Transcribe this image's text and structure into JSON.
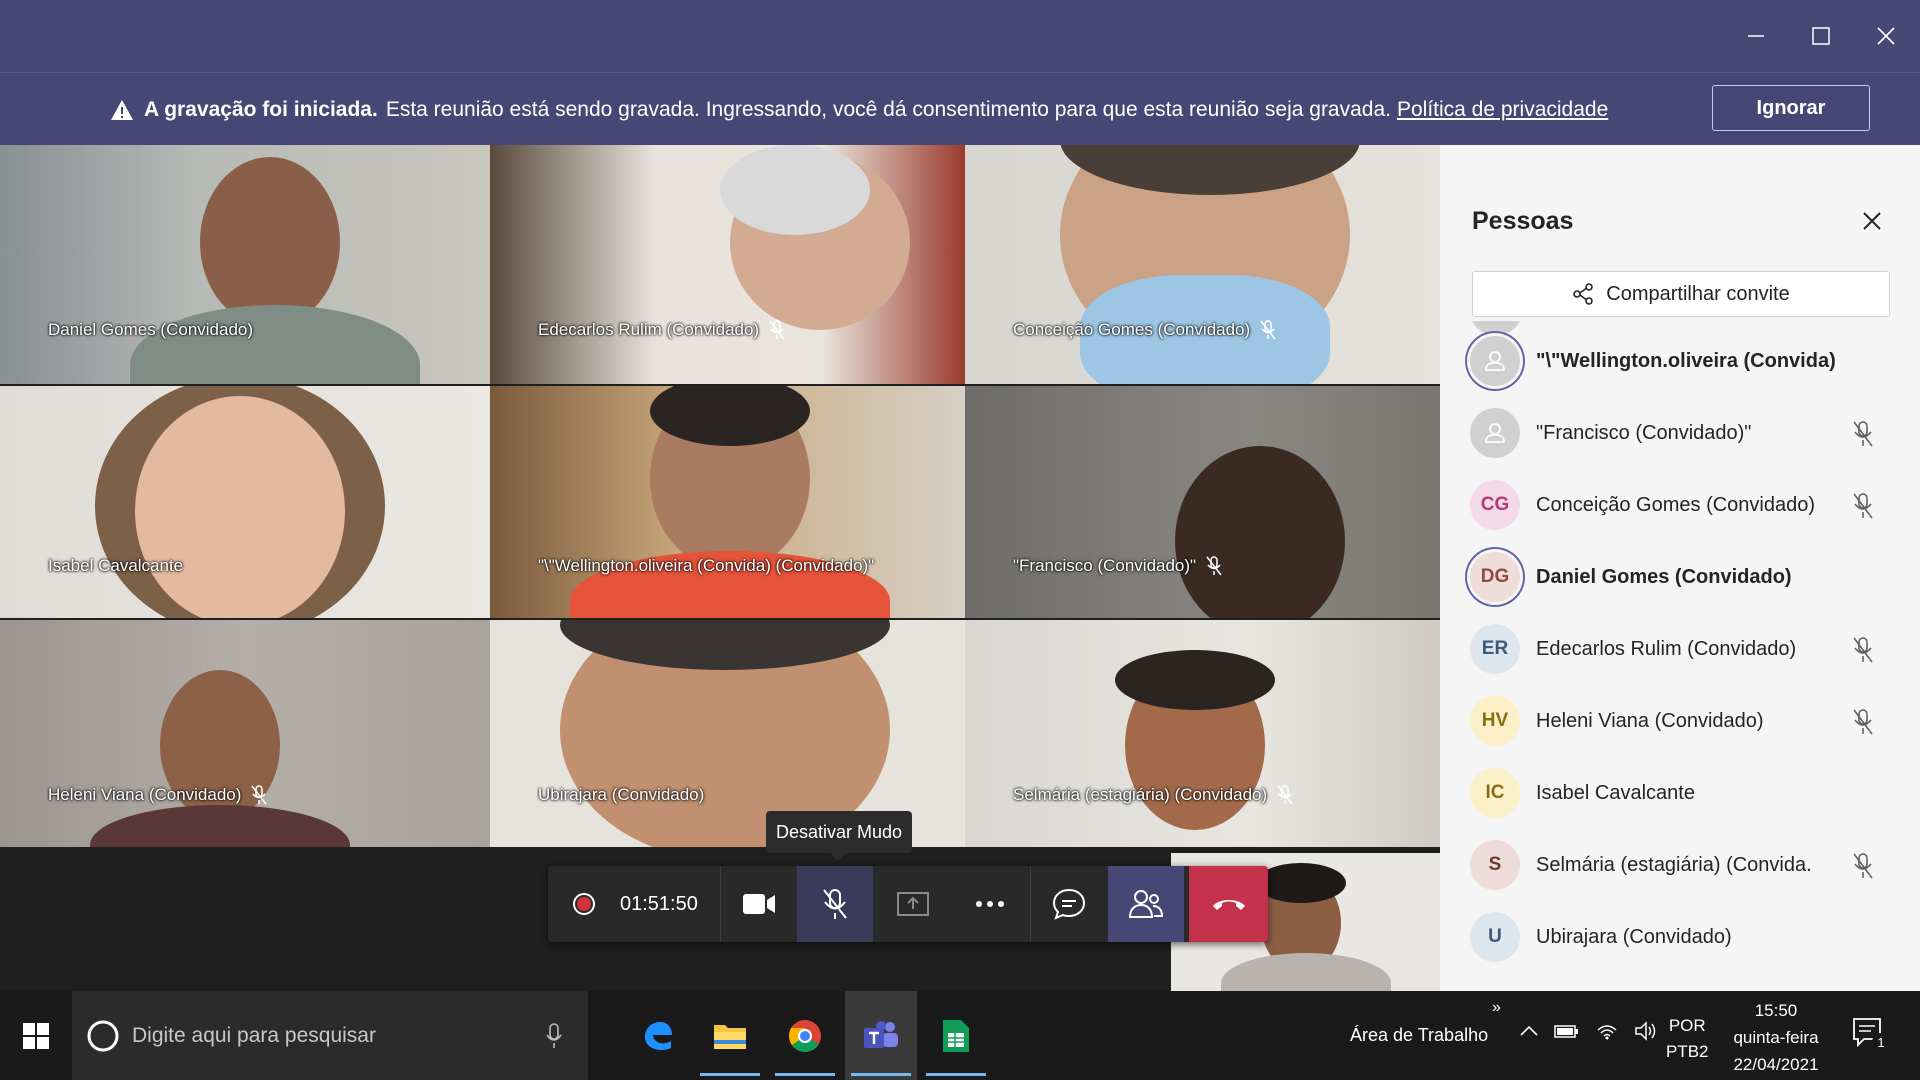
{
  "window": {
    "minimize_icon": "minimize-icon",
    "maximize_icon": "maximize-icon",
    "close_icon": "close-icon"
  },
  "banner": {
    "bold_text": "A gravação foi iniciada.",
    "text": "Esta reunião está sendo gravada. Ingressando, você dá consentimento para que esta reunião seja gravada.",
    "link": "Política de privacidade",
    "button": "Ignorar"
  },
  "tiles": [
    {
      "name": "Daniel Gomes (Convidado)",
      "muted": false
    },
    {
      "name": "Edecarlos Rulim (Convidado)",
      "muted": true
    },
    {
      "name": "Conceição Gomes (Convidado)",
      "muted": true
    },
    {
      "name": "Isabel Cavalcante",
      "muted": false
    },
    {
      "name": "\"\\\"Wellington.oliveira (Convida) (Convidado)\"",
      "muted": false
    },
    {
      "name": "\"Francisco (Convidado)\"",
      "muted": true
    },
    {
      "name": "Heleni Viana (Convidado)",
      "muted": true
    },
    {
      "name": "Ubirajara (Convidado)",
      "muted": false
    },
    {
      "name": "Selmária (estagiária) (Convidado)",
      "muted": true
    }
  ],
  "callbar": {
    "timer": "01:51:50",
    "tooltip": "Desativar Mudo"
  },
  "panel": {
    "title": "Pessoas",
    "share_button": "Compartilhar convite",
    "people": [
      {
        "name": "\"\\\"Wellington.oliveira (Convida) .",
        "initials": "",
        "bold": true,
        "muted": false,
        "avatar_color": "#d0d0d0",
        "text_color": "#fff",
        "ring": true
      },
      {
        "name": "\"Francisco (Convidado)\"",
        "initials": "",
        "bold": false,
        "muted": true,
        "avatar_color": "#d0d0d0",
        "text_color": "#fff",
        "ring": false
      },
      {
        "name": "Conceição Gomes (Convidado)",
        "initials": "CG",
        "bold": false,
        "muted": true,
        "avatar_color": "#f4d9e6",
        "text_color": "#b23c7b",
        "ring": false
      },
      {
        "name": "Daniel Gomes (Convidado)",
        "initials": "DG",
        "bold": true,
        "muted": false,
        "avatar_color": "#eeddd8",
        "text_color": "#8e4a3a",
        "ring": true
      },
      {
        "name": "Edecarlos Rulim (Convidado)",
        "initials": "ER",
        "bold": false,
        "muted": true,
        "avatar_color": "#dde5ee",
        "text_color": "#3c5a7a",
        "ring": false
      },
      {
        "name": "Heleni Viana (Convidado)",
        "initials": "HV",
        "bold": false,
        "muted": true,
        "avatar_color": "#fbf0c8",
        "text_color": "#8a6d12",
        "ring": false
      },
      {
        "name": "Isabel Cavalcante",
        "initials": "IC",
        "bold": false,
        "muted": false,
        "avatar_color": "#fbf0c8",
        "text_color": "#8a6d12",
        "ring": false
      },
      {
        "name": "Selmária (estagiária) (Convida.",
        "initials": "S",
        "bold": false,
        "muted": true,
        "avatar_color": "#eedcd8",
        "text_color": "#6a3a30",
        "ring": false
      },
      {
        "name": "Ubirajara (Convidado)",
        "initials": "U",
        "bold": false,
        "muted": false,
        "avatar_color": "#dde5ee",
        "text_color": "#3c5a7a",
        "ring": false
      }
    ]
  },
  "taskbar": {
    "search_placeholder": "Digite aqui para pesquisar",
    "desktop_label": "Área de Trabalho",
    "lang_top": "POR",
    "lang_bottom": "PTB2",
    "time": "15:50",
    "day": "quinta-feira",
    "date": "22/04/2021",
    "notification_count": "1"
  },
  "colors": {
    "teams_purple": "#464775",
    "accent": "#6264a7",
    "hangup": "#c4314b"
  }
}
